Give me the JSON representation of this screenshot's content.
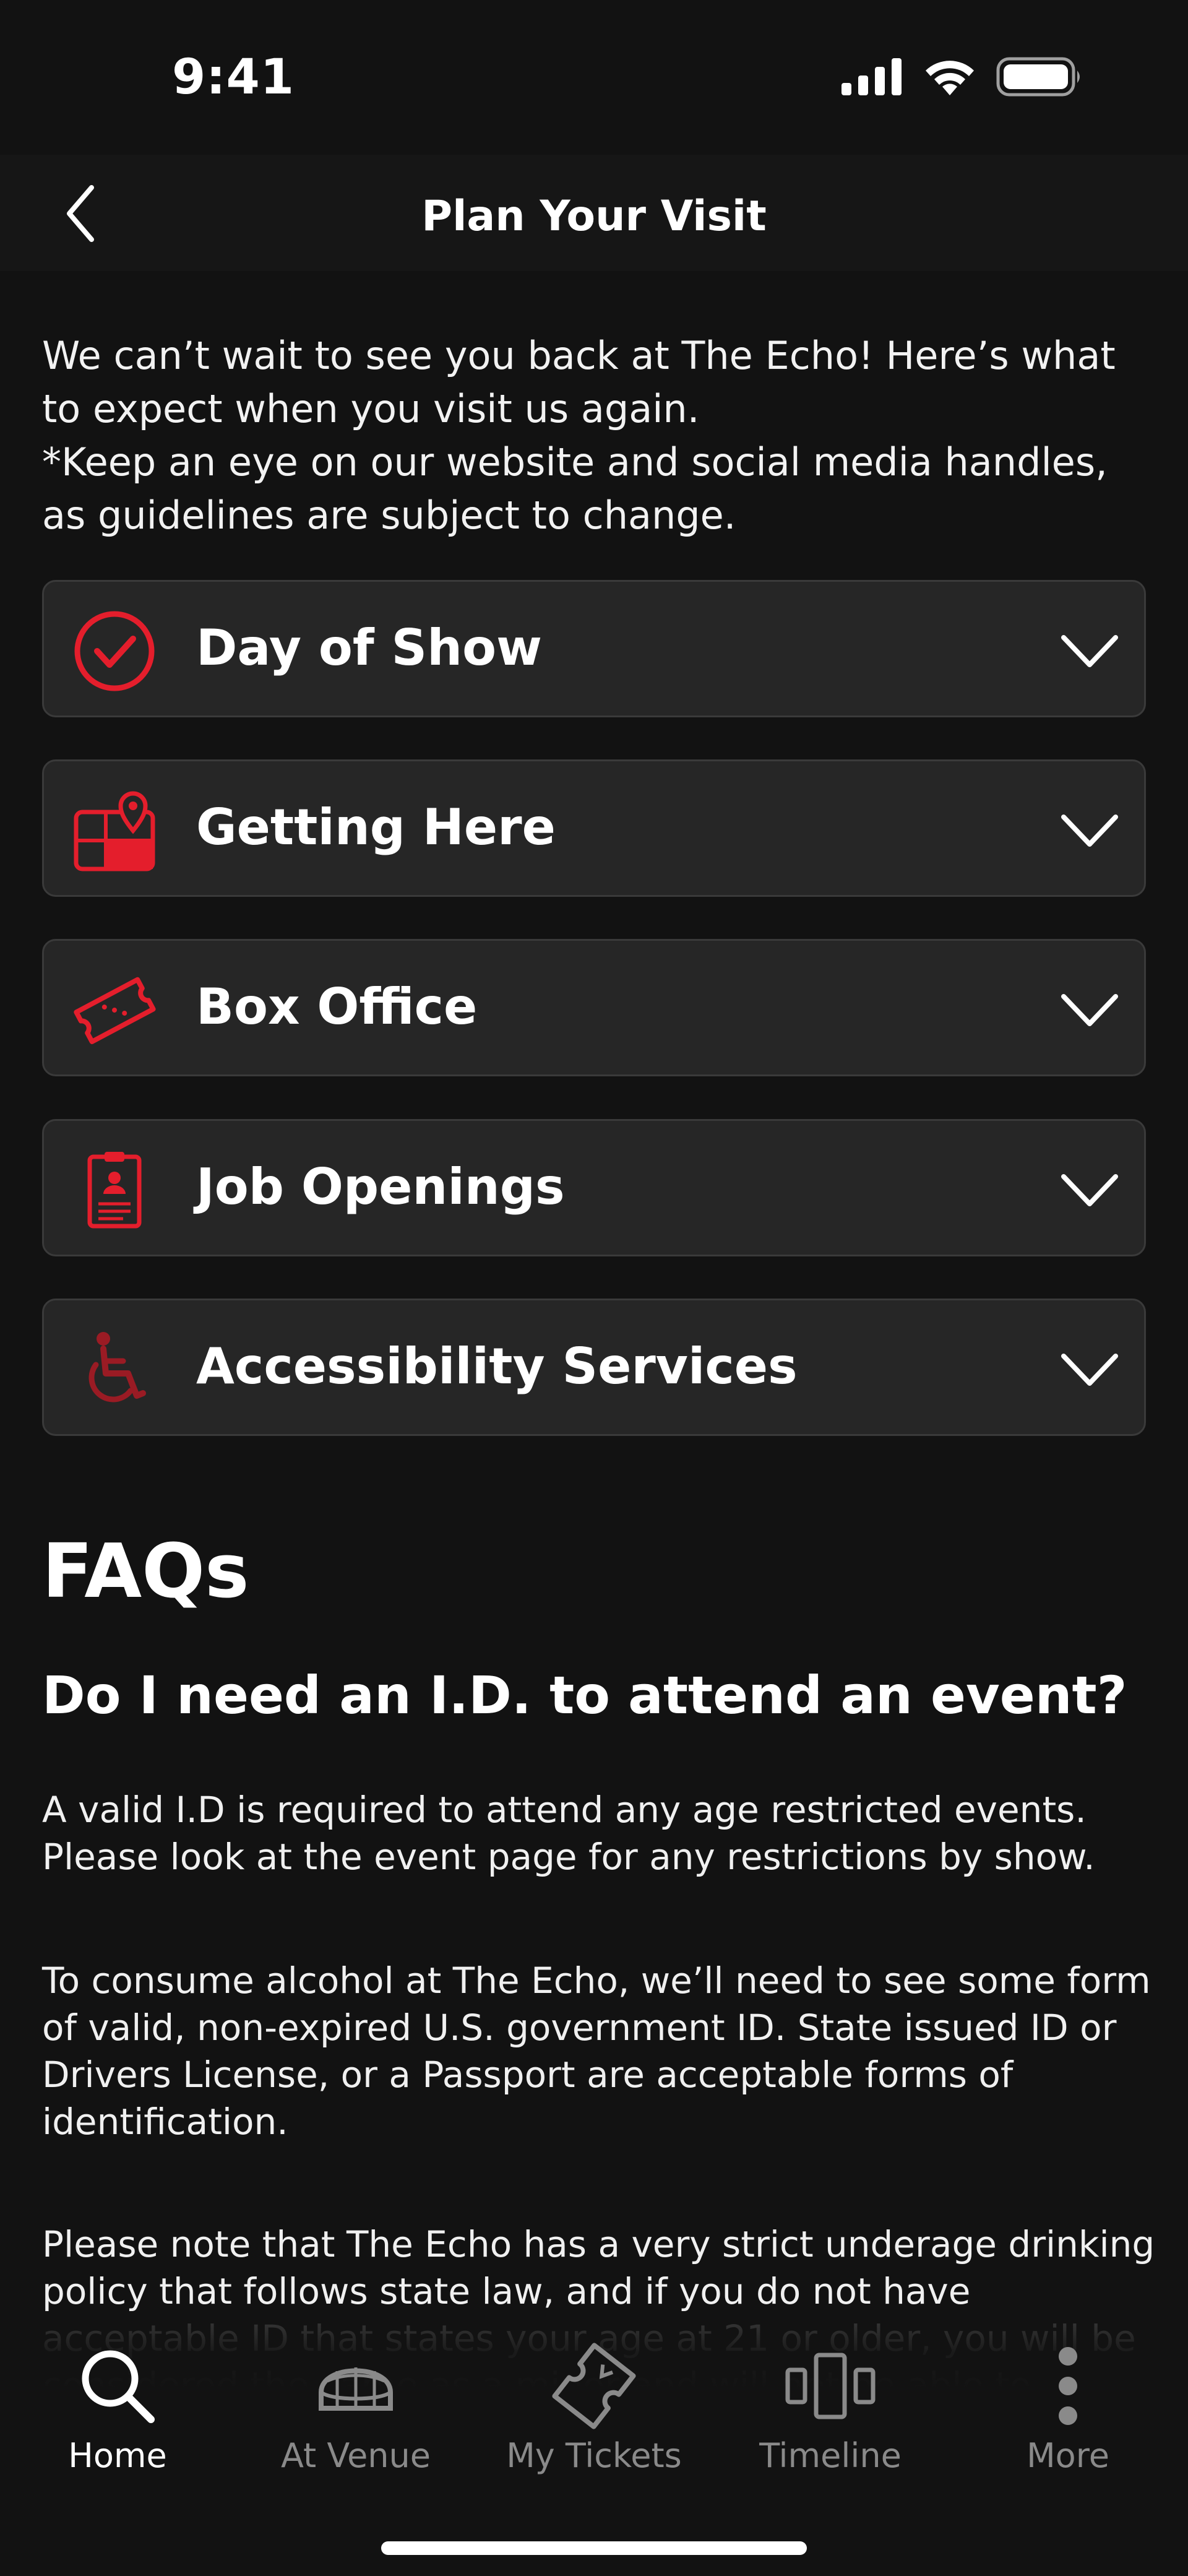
{
  "status_bar": {
    "time": "9:41"
  },
  "header": {
    "title": "Plan Your Visit"
  },
  "intro": {
    "line1": "We can’t wait to see you back at The Echo! Here’s what to expect when you visit us again.",
    "line2": "*Keep an eye on our website and social media handles, as guidelines are subject to change."
  },
  "sections": [
    {
      "label": "Day of Show",
      "icon": "check-circle-icon"
    },
    {
      "label": "Getting Here",
      "icon": "map-pin-icon"
    },
    {
      "label": "Box Office",
      "icon": "ticket-icon"
    },
    {
      "label": "Job Openings",
      "icon": "resume-icon"
    },
    {
      "label": "Accessibility Services",
      "icon": "wheelchair-icon"
    }
  ],
  "faq": {
    "title": "FAQs",
    "question": "Do I need an I.D. to attend an event?",
    "paragraphs": [
      "A valid I.D is required to attend any age restricted events. Please look at the event page for any restrictions by show.",
      "To consume alcohol at The Echo, we’ll need to see some form of valid, non-expired U.S. government ID. State issued ID or Drivers License, or a Passport are acceptable forms of identification.",
      "Please note that The Echo has a very strict underage drinking policy that follows state law, and if you do not have acceptable ID that states your age at 21 or older, you will be considered the same as a minor and will not be able to"
    ]
  },
  "tabs": [
    {
      "label": "Home",
      "icon": "search-icon",
      "active": true
    },
    {
      "label": "At Venue",
      "icon": "venue-icon",
      "active": false
    },
    {
      "label": "My Tickets",
      "icon": "ticket-icon",
      "active": false
    },
    {
      "label": "Timeline",
      "icon": "timeline-icon",
      "active": false
    },
    {
      "label": "More",
      "icon": "more-icon",
      "active": false
    }
  ],
  "colors": {
    "accent": "#e41e2c",
    "background": "#121212",
    "card": "#262626"
  }
}
